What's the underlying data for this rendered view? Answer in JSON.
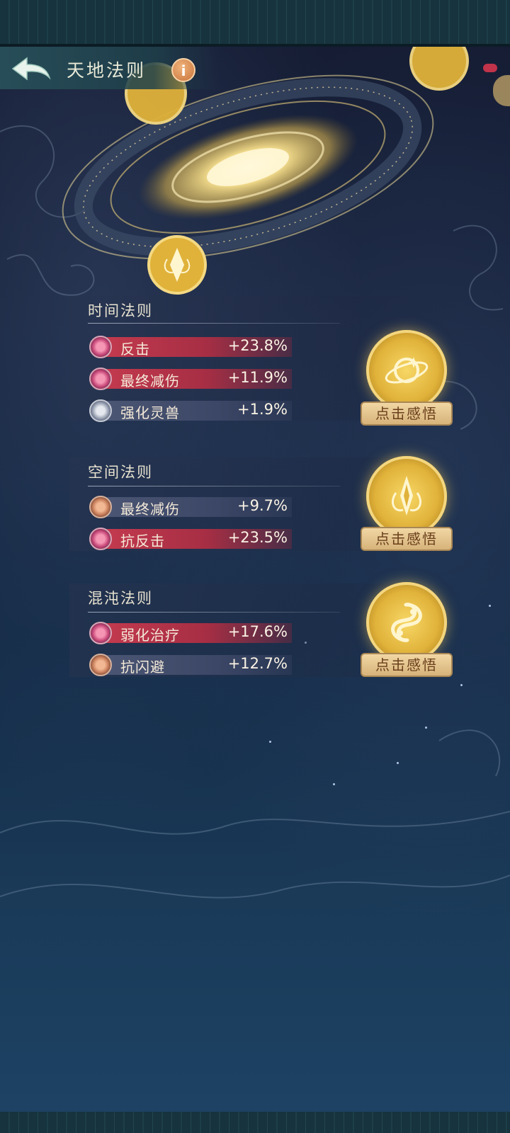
{
  "header": {
    "title": "天地法则",
    "info_label": "i"
  },
  "sections": [
    {
      "title": "时间法则",
      "button_label": "点击感悟",
      "stats": [
        {
          "name": "反击",
          "value": "+23.8%"
        },
        {
          "name": "最终减伤",
          "value": "+11.9%"
        },
        {
          "name": "强化灵兽",
          "value": "+1.9%"
        }
      ]
    },
    {
      "title": "空间法则",
      "button_label": "点击感悟",
      "stats": [
        {
          "name": "最终减伤",
          "value": "+9.7%"
        },
        {
          "name": "抗反击",
          "value": "+23.5%"
        }
      ]
    },
    {
      "title": "混沌法则",
      "button_label": "点击感悟",
      "stats": [
        {
          "name": "弱化治疗",
          "value": "+17.6%"
        },
        {
          "name": "抗闪避",
          "value": "+12.7%"
        }
      ]
    }
  ],
  "colors": {
    "accent_gold": "#e0b23a",
    "stat_red": "#c33a4e",
    "stat_grey": "#4b5674",
    "button_bg": "#d7b37a"
  }
}
